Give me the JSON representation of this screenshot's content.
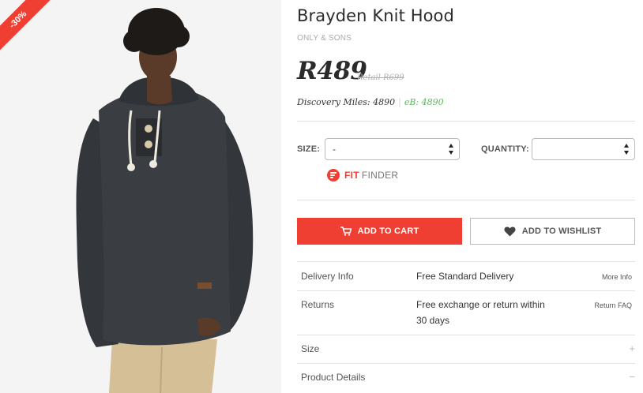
{
  "badge": {
    "discount": "-30%"
  },
  "product": {
    "title": "Brayden Knit Hood",
    "brand": "ONLY & SONS",
    "price": "R489",
    "retail": "Retail R699",
    "miles": "Discovery Miles: 4890",
    "ebucks": "eB: 4890"
  },
  "options": {
    "size_label": "SIZE:",
    "size_value": "-",
    "quantity_label": "QUANTITY:",
    "quantity_value": ""
  },
  "fit_finder": {
    "part1": "FIT",
    "part2": "FINDER"
  },
  "buttons": {
    "add_to_cart": "ADD TO CART",
    "add_to_wishlist": "ADD TO WISHLIST"
  },
  "info": {
    "delivery": {
      "label": "Delivery Info",
      "value": "Free Standard Delivery",
      "link": "More Info"
    },
    "returns": {
      "label": "Returns",
      "value_line1": "Free exchange or return within",
      "value_line2": "30 days",
      "link": "Return FAQ"
    },
    "size": {
      "label": "Size",
      "sign": "+"
    },
    "details": {
      "label": "Product Details",
      "sign": "−"
    }
  },
  "colors": {
    "accent": "#ef3f33",
    "ebucks": "#5cb85c",
    "sweater": "#3a3d42",
    "chinos": "#d4bf97"
  }
}
